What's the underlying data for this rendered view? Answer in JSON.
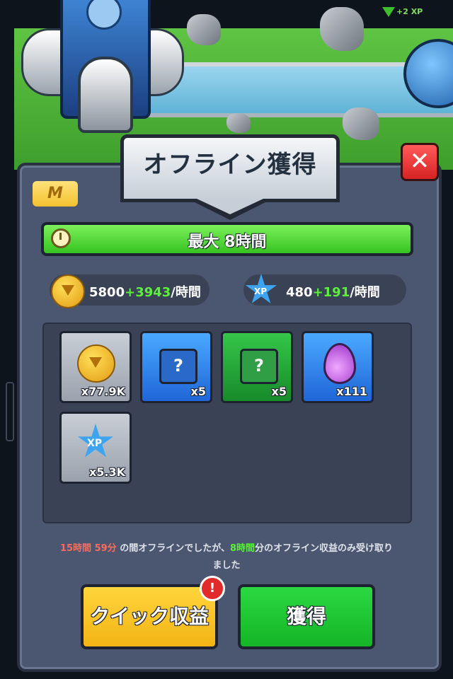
{
  "hud": {
    "xp_gain": "+2 XP"
  },
  "dialog": {
    "title": "オフライン獲得",
    "close_label": "✕",
    "badge": "M",
    "max_time": "最大 8時間"
  },
  "rates": {
    "coin": {
      "base": "5800",
      "bonus": "+3943",
      "unit": "/時間"
    },
    "xp": {
      "base": "480",
      "bonus": "+191",
      "unit": "/時間",
      "icon_label": "XP"
    }
  },
  "rewards": [
    {
      "type": "coin",
      "qty": "x77.9K",
      "icon": "coin-icon"
    },
    {
      "type": "blue-scroll",
      "qty": "x5",
      "icon": "mystery-scroll-blue-icon",
      "symbol": "?"
    },
    {
      "type": "green-scroll",
      "qty": "x5",
      "icon": "mystery-scroll-green-icon",
      "symbol": "?"
    },
    {
      "type": "essence",
      "qty": "x111",
      "icon": "purple-drop-icon"
    },
    {
      "type": "xp",
      "qty": "x5.3K",
      "icon": "xp-star-icon",
      "symbol": "XP"
    }
  ],
  "message": {
    "offline_hours": "15時間",
    "offline_minutes": "59分",
    "part1": "の間オフラインでしたが、",
    "capped_hours": "8時間",
    "part2": "分のオフライン収益のみ受け取りました"
  },
  "buttons": {
    "quick_earn": "クイック収益",
    "claim": "獲得",
    "alert": "!"
  },
  "colors": {
    "green_bar": "#36c321",
    "panel": "#4b5670",
    "quick_button": "#f3b414",
    "claim_button": "#14b526",
    "close_button": "#d62323"
  }
}
